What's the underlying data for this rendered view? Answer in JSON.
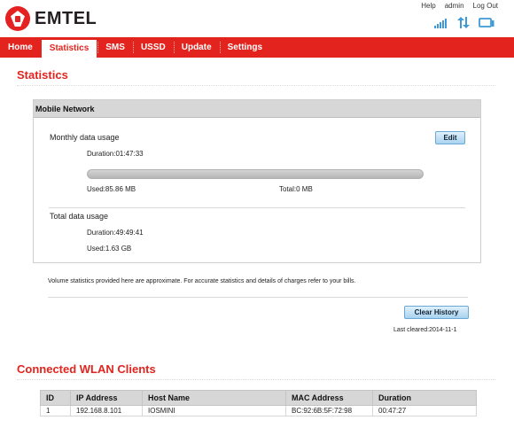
{
  "brand": {
    "name": "EMTEL"
  },
  "top_links": [
    "Help",
    "admin",
    "Log Out"
  ],
  "status_icons": [
    "signal-strength-icon",
    "data-transfer-icon",
    "connected-device-icon"
  ],
  "nav": {
    "items": [
      {
        "label": "Home",
        "active": false
      },
      {
        "label": "Statistics",
        "active": true
      },
      {
        "label": "SMS",
        "active": false
      },
      {
        "label": "USSD",
        "active": false
      },
      {
        "label": "Update",
        "active": false
      },
      {
        "label": "Settings",
        "active": false
      }
    ]
  },
  "statistics": {
    "title": "Statistics",
    "panel_title": "Mobile Network",
    "monthly": {
      "label": "Monthly data usage",
      "duration": "Duration:01:47:33",
      "used": "Used:85.86 MB",
      "total": "Total:0 MB",
      "usage_fraction": 0,
      "edit_label": "Edit"
    },
    "total": {
      "label": "Total data usage",
      "duration": "Duration:49:49:41",
      "used": "Used:1.63 GB"
    },
    "note": "Volume statistics provided here are approximate. For accurate statistics and details of charges refer to your bills.",
    "clear_history_label": "Clear History",
    "last_cleared": "Last cleared:2014-11-1"
  },
  "wlan": {
    "title": "Connected WLAN Clients",
    "columns": [
      "ID",
      "IP Address",
      "Host Name",
      "MAC Address",
      "Duration"
    ],
    "rows": [
      [
        "1",
        "192.168.8.101",
        "IOSMINI",
        "BC:92:6B:5F:72:98",
        "00:47:27"
      ]
    ]
  },
  "colors": {
    "brand_red": "#e3241e",
    "accent_blue": "#3d9ad6"
  }
}
